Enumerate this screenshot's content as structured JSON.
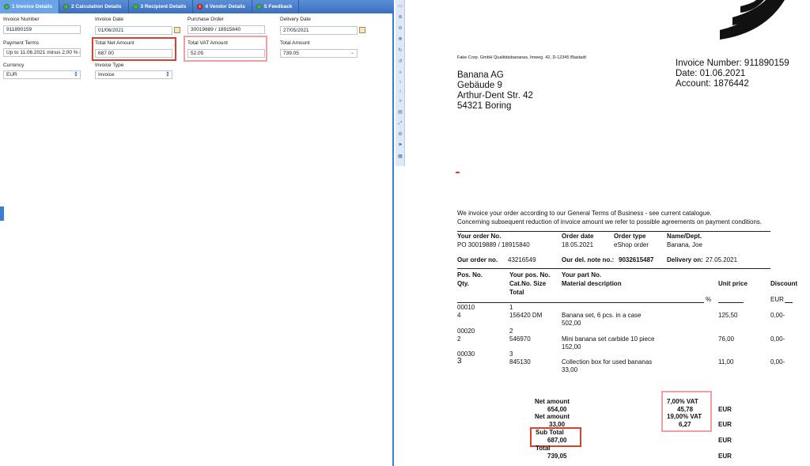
{
  "tabs": [
    {
      "label": "1 Invoice Details",
      "status": "ok"
    },
    {
      "label": "2 Calculation Details",
      "status": "ok"
    },
    {
      "label": "3 Recipient Details",
      "status": "ok"
    },
    {
      "label": "4 Vendor Details",
      "status": "error"
    },
    {
      "label": "5 Feedback",
      "status": "ok"
    }
  ],
  "form": {
    "invoice_number": {
      "label": "Invoice Number",
      "value": "911890159"
    },
    "invoice_date": {
      "label": "Invoice Date",
      "value": "01/06/2021"
    },
    "purchase_order": {
      "label": "Purchase Order",
      "value": "30019889 / 18915840"
    },
    "delivery_date": {
      "label": "Delivery Date",
      "value": "27/05/2021"
    },
    "payment_terms": {
      "label": "Payment Terms",
      "value": "Up to 11.06.2021 minus 2,00 % c"
    },
    "total_net_amount": {
      "label": "Total Net Amount",
      "value": "687.00"
    },
    "total_vat_amount": {
      "label": "Total VAT Amount",
      "value": "52.05"
    },
    "total_amount": {
      "label": "Total Amount",
      "value": "739.05"
    },
    "currency": {
      "label": "Currency",
      "value": "EUR"
    },
    "invoice_type": {
      "label": "Invoice Type",
      "value": "Invoice"
    }
  },
  "colors": {
    "accent": "#3c6fbf",
    "highlight_strong": "#d9412b",
    "highlight_soft": "#f0a0a0"
  },
  "doc": {
    "sender_line": "Fake Corp. GmbH Qualitätsbananas, Imweg. 42, D-12345 Blastadt",
    "recipient": [
      "Banana AG",
      "Gebäude 9",
      "Arthur-Dent Str. 42",
      "54321 Boring"
    ],
    "invoice_info": [
      "Invoice Number: 911890159",
      "Date: 01.06.2021",
      "Account: 1876442"
    ],
    "intro": [
      "We invoice your order according to our General Terms of Business - see current catalogue.",
      "Concerning subsequent reduction of invoice amount we refer to possible agreements on payment conditions."
    ],
    "order_headers": [
      "Your order No.",
      "Order date",
      "Order type",
      "Name/Dept."
    ],
    "order_values": [
      "PO 30019889 / 18915840",
      "18.05.2021",
      "eShop order",
      "Banana, Joe"
    ],
    "our_order_label": "Our order no.",
    "our_order_value": "43216549",
    "del_note_label": "Our del. note no.:",
    "del_note_value": "9032615487",
    "delivery_on_label": "Delivery on:",
    "delivery_on_value": "27.05.2021",
    "item_headers": {
      "pos": "Pos. No.",
      "qty": "Qty.",
      "your_pos": "Your pos. No.",
      "cat": "Cat.No. Size",
      "total": "Total",
      "part": "Your part No.",
      "material": "Material description",
      "unit_price": "Unit price",
      "discount": "Discount",
      "pct": "%",
      "eur": "EUR"
    },
    "items": [
      {
        "pos": "00010",
        "qty": "4",
        "your_pos": "1",
        "cat": "156420 DM",
        "desc": "Banana set, 6 pcs. in a case",
        "total": "502,00",
        "unit": "125,50",
        "disc": "0,00-"
      },
      {
        "pos": "00020",
        "qty": "2",
        "your_pos": "2",
        "cat": "546970",
        "desc": "Mini banana set carbide 10 piece",
        "total": "152,00",
        "unit": "76,00",
        "disc": "0,00-"
      },
      {
        "pos": "00030",
        "qty": "3",
        "your_pos": "3",
        "cat": "845130",
        "desc": "Collection box for used bananas",
        "total": "33,00",
        "unit": "11,00",
        "disc": "0,00-"
      }
    ],
    "totals": {
      "net1_label": "Net amount",
      "net1_value": "654,00",
      "net2_label": "Net amount",
      "net2_value": "33,00",
      "sub_label": "Sub Total",
      "sub_value": "687,00",
      "total_label": "Total",
      "total_value": "739,05",
      "vat1_label": "7,00% VAT",
      "vat1_value": "45,78",
      "vat2_label": "19,00% VAT",
      "vat2_value": "6,27",
      "currency": "EUR"
    }
  }
}
